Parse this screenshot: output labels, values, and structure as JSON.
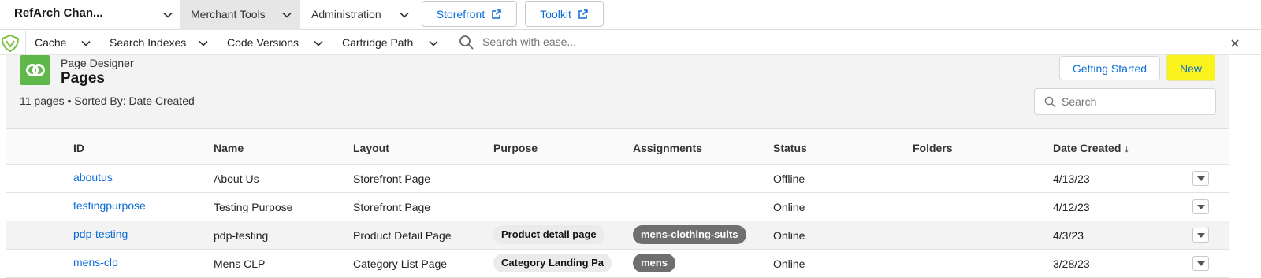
{
  "top_nav": {
    "app_name": "RefArch Chan...",
    "tabs": [
      {
        "label": "Merchant Tools",
        "active": true
      },
      {
        "label": "Administration",
        "active": false
      }
    ],
    "storefront_label": "Storefront",
    "toolkit_label": "Toolkit"
  },
  "sub_nav": {
    "menus": [
      "Cache",
      "Search Indexes",
      "Code Versions",
      "Cartridge Path"
    ],
    "search_placeholder": "Search with ease..."
  },
  "header": {
    "app_label": "Page Designer",
    "title": "Pages",
    "summary": "11 pages • Sorted By: Date Created",
    "getting_started_label": "Getting Started",
    "new_label": "New",
    "search_placeholder": "Search"
  },
  "table": {
    "columns": [
      "ID",
      "Name",
      "Layout",
      "Purpose",
      "Assignments",
      "Status",
      "Folders",
      "Date Created ↓"
    ],
    "rows": [
      {
        "id": "aboutus",
        "name": "About Us",
        "layout": "Storefront Page",
        "purpose": "",
        "assignment": "",
        "status": "Offline",
        "folders": "",
        "date": "4/13/23"
      },
      {
        "id": "testingpurpose",
        "name": "Testing Purpose",
        "layout": "Storefront Page",
        "purpose": "",
        "assignment": "",
        "status": "Online",
        "folders": "",
        "date": "4/12/23"
      },
      {
        "id": "pdp-testing",
        "name": "pdp-testing",
        "layout": "Product Detail Page",
        "purpose": "Product detail page",
        "assignment": "mens-clothing-suits",
        "status": "Online",
        "folders": "",
        "date": "4/3/23"
      },
      {
        "id": "mens-clp",
        "name": "Mens CLP",
        "layout": "Category List Page",
        "purpose": "Category Landing Pa",
        "assignment": "mens",
        "status": "Online",
        "folders": "",
        "date": "3/28/23"
      }
    ]
  },
  "colors": {
    "accent": "#0b6cd8",
    "highlight": "#fbf41c",
    "brand_green": "#5fb84a",
    "assignment_pill": "#6f6f6f"
  }
}
